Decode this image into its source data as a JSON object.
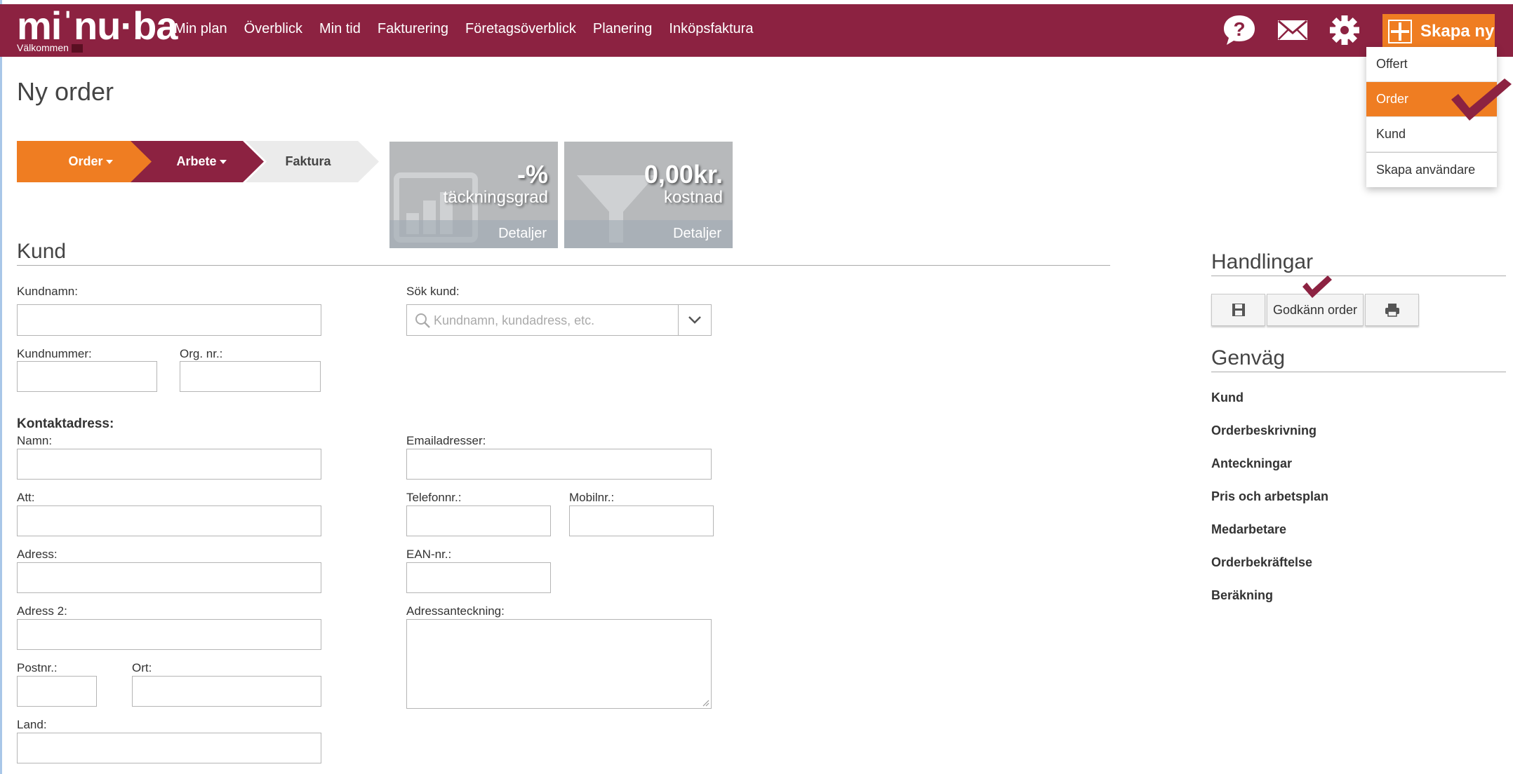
{
  "brand": {
    "logo_text": "miˈnu·ba",
    "welcome": "Välkommen"
  },
  "nav": [
    "Min plan",
    "Överblick",
    "Min tid",
    "Fakturering",
    "Företagsöverblick",
    "Planering",
    "Inköpsfaktura"
  ],
  "toolbar": {
    "create_label": "Skapa ny"
  },
  "create_menu": [
    "Offert",
    "Order",
    "Kund",
    "Skapa användare"
  ],
  "create_menu_active": "Order",
  "page": {
    "title": "Ny order"
  },
  "steps": [
    "Order",
    "Arbete",
    "Faktura"
  ],
  "stats": {
    "coverage": {
      "value": "-%",
      "label": "täckningsgrad",
      "footer": "Detaljer"
    },
    "cost": {
      "value": "0,00kr.",
      "label": "kostnad",
      "footer": "Detaljer"
    }
  },
  "customer": {
    "section_title": "Kund",
    "name_label": "Kundnamn:",
    "search_label": "Sök kund:",
    "search_placeholder": "Kundnamn, kundadress, etc.",
    "number_label": "Kundnummer:",
    "org_label": "Org. nr.:"
  },
  "contact": {
    "heading": "Kontaktadress:",
    "name": "Namn:",
    "emails": "Emailadresser:",
    "att": "Att:",
    "phone": "Telefonnr.:",
    "mobile": "Mobilnr.:",
    "address": "Adress:",
    "ean": "EAN-nr.:",
    "address2": "Adress 2:",
    "address_note": "Adressanteckning:",
    "postal": "Postnr.:",
    "city": "Ort:",
    "country": "Land:"
  },
  "actions": {
    "title": "Handlingar",
    "approve_label": "Godkänn order"
  },
  "shortcuts": {
    "title": "Genväg",
    "items": [
      "Kund",
      "Orderbeskrivning",
      "Anteckningar",
      "Pris och arbetsplan",
      "Medarbetare",
      "Orderbekräftelse",
      "Beräkning"
    ]
  },
  "colors": {
    "brand": "#8c2241",
    "accent": "#ef7d22",
    "stat_bg": "#b7b9bb"
  }
}
